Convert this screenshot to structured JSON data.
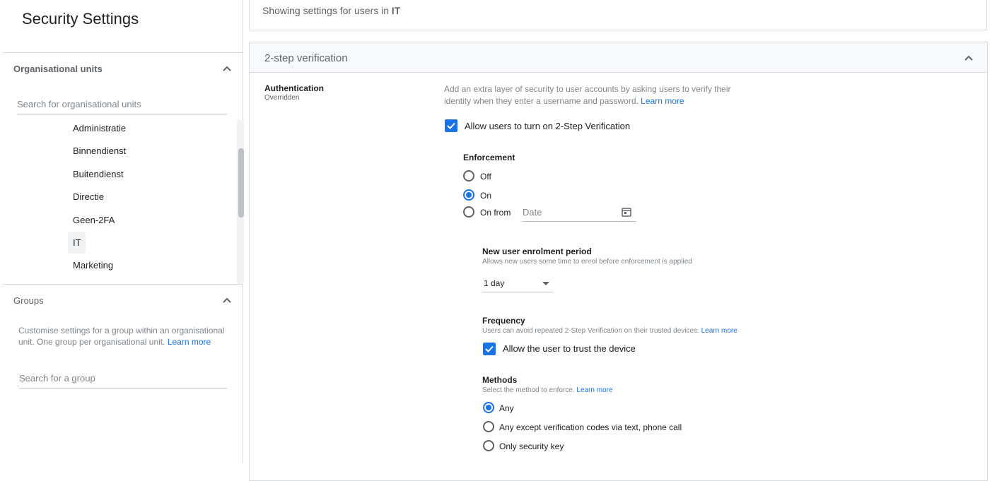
{
  "sidebar": {
    "title": "Security Settings",
    "org_units": {
      "header": "Organisational units",
      "search_placeholder": "Search for organisational units",
      "items": [
        "Administratie",
        "Binnendienst",
        "Buitendienst",
        "Directie",
        "Geen-2FA",
        "IT",
        "Marketing"
      ],
      "selected": "IT"
    },
    "groups": {
      "header": "Groups",
      "description": "Customise settings for a group within an organisational unit. One group per organisational unit.",
      "learn_more": "Learn more",
      "search_placeholder": "Search for a group"
    }
  },
  "main": {
    "banner_prefix": "Showing settings for users in",
    "banner_unit": "IT",
    "section_title": "2-step verification",
    "authentication": {
      "label": "Authentication",
      "status": "Overridden",
      "description": "Add an extra layer of security to user accounts by asking users to verify their identity when they enter a username and password.",
      "learn_more": "Learn more",
      "allow_label": "Allow users to turn on 2-Step Verification",
      "allow_checked": true
    },
    "enforcement": {
      "title": "Enforcement",
      "options": [
        "Off",
        "On",
        "On from"
      ],
      "selected": "On",
      "date_placeholder": "Date"
    },
    "enrolment": {
      "title": "New user enrolment period",
      "description": "Allows new users some time to enrol before enforcement is applied",
      "value": "1 day"
    },
    "frequency": {
      "title": "Frequency",
      "description": "Users can avoid repeated 2-Step Verification on their trusted devices.",
      "learn_more": "Learn more",
      "trust_label": "Allow the user to trust the device",
      "trust_checked": true
    },
    "methods": {
      "title": "Methods",
      "description": "Select the method to enforce.",
      "learn_more": "Learn more",
      "options": [
        "Any",
        "Any except verification codes via text, phone call",
        "Only security key"
      ],
      "selected": "Any"
    }
  },
  "colors": {
    "accent": "#1a73e8",
    "border": "#dadce0",
    "muted": "#5f6368"
  }
}
